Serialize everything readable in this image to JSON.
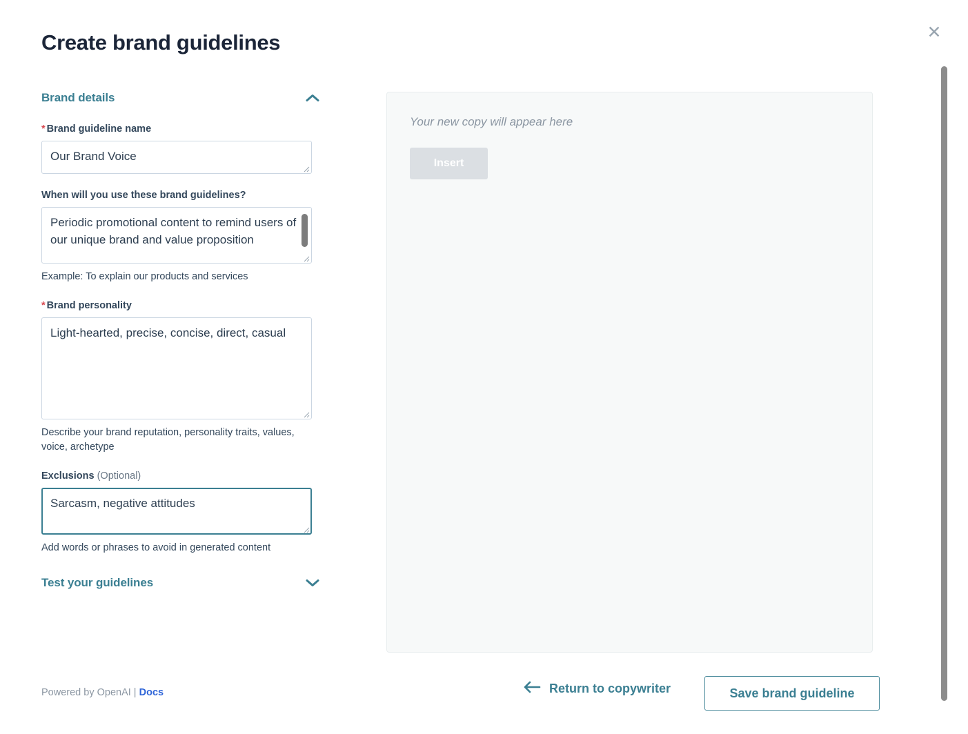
{
  "colors": {
    "teal": "#3b7f92",
    "title": "#1b2538",
    "label": "#33475b",
    "required": "#d94c53",
    "docs_link": "#2f65d8",
    "panel_bg": "#f7f9f9",
    "disabled_button": "#dbdfe3",
    "border": "#cbd6e2"
  },
  "header": {
    "title": "Create brand guidelines",
    "close_icon": "close-icon",
    "close_label": "✕"
  },
  "sections": {
    "brand_details": {
      "title": "Brand details",
      "expanded": true,
      "chevron_icon": "chevron-up-icon"
    },
    "test_guidelines": {
      "title": "Test your guidelines",
      "expanded": false,
      "chevron_icon": "chevron-down-icon"
    }
  },
  "fields": {
    "guideline_name": {
      "label": "Brand guideline name",
      "required": true,
      "required_marker": "*",
      "value": "Our Brand Voice",
      "placeholder": "",
      "helper": "",
      "focused": false
    },
    "usage": {
      "label": "When will you use these brand guidelines?",
      "required": false,
      "value": "Periodic promotional content to remind users of our unique brand and value proposition",
      "placeholder": "",
      "helper": "Example: To explain our products and services",
      "focused": false,
      "scrolled": true
    },
    "personality": {
      "label": "Brand personality",
      "required": true,
      "required_marker": "*",
      "value": "Light-hearted, precise, concise, direct, casual",
      "placeholder": "",
      "helper": "Describe your brand reputation, personality traits, values, voice, archetype",
      "focused": false
    },
    "exclusions": {
      "label": "Exclusions",
      "optional_suffix": "(Optional)",
      "required": false,
      "value": "Sarcasm, negative attitudes",
      "placeholder": "",
      "helper": "Add words or phrases to avoid in generated content",
      "focused": true
    }
  },
  "preview_panel": {
    "placeholder": "Your new copy will appear here",
    "insert_label": "Insert",
    "insert_disabled": true
  },
  "footer": {
    "powered_by": "Powered by OpenAI |",
    "docs_label": "Docs",
    "return_label": "Return to copywriter",
    "return_icon": "arrow-left-icon",
    "save_label": "Save brand guideline"
  }
}
